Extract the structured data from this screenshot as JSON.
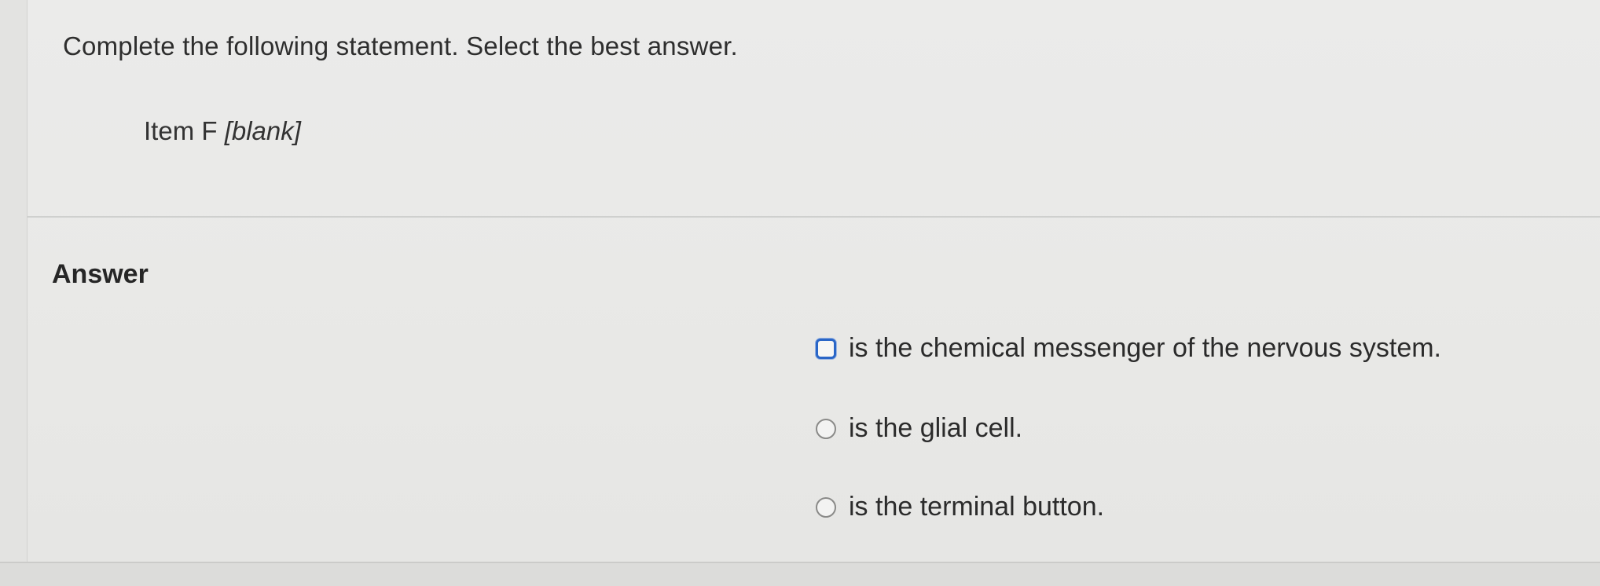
{
  "question": {
    "prompt": "Complete the following statement. Select the best answer.",
    "item_prefix": "Item F ",
    "item_blank": "[blank]"
  },
  "answer": {
    "heading": "Answer",
    "options": [
      {
        "label": "is the chemical messenger of the nervous system.",
        "selected": false,
        "focused": true
      },
      {
        "label": "is the glial cell.",
        "selected": false,
        "focused": false
      },
      {
        "label": "is the terminal button.",
        "selected": false,
        "focused": false
      }
    ]
  },
  "colors": {
    "focus_ring": "#2a66c7",
    "background": "#e9e9e7"
  },
  "icons": {
    "radio": "radio-button-icon"
  }
}
